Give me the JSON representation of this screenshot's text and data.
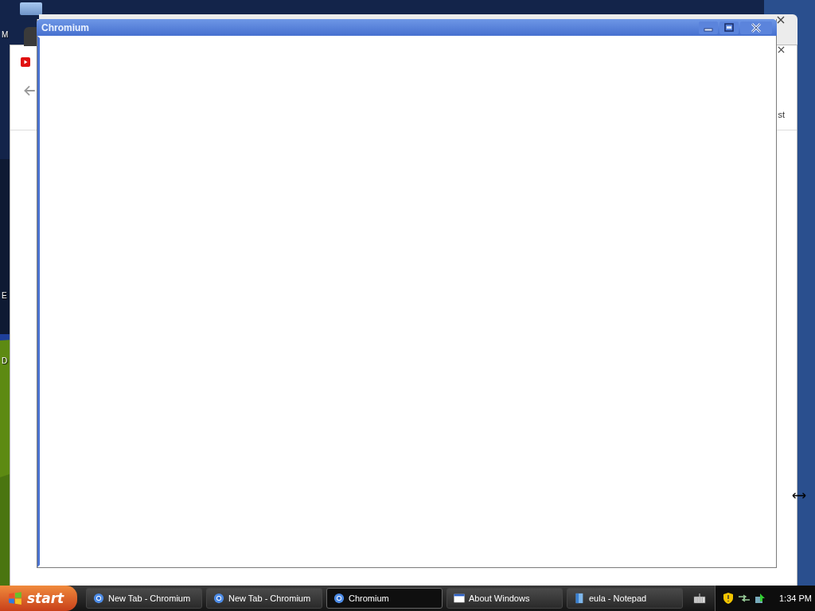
{
  "desktop": {
    "icon_labels": [
      "M",
      "E",
      "D"
    ]
  },
  "background_window": {
    "text_fragment": "st"
  },
  "window": {
    "title": "Chromium"
  },
  "taskbar": {
    "start": "start",
    "tasks": [
      {
        "label": "New Tab - Chromium",
        "kind": "browser",
        "selected": false
      },
      {
        "label": "New Tab - Chromium",
        "kind": "browser",
        "selected": false
      },
      {
        "label": "Chromium",
        "kind": "browser",
        "selected": true
      },
      {
        "label": "About Windows",
        "kind": "window",
        "selected": false
      },
      {
        "label": "eula - Notepad",
        "kind": "notepad",
        "selected": false
      }
    ],
    "clock": "1:34 PM"
  }
}
